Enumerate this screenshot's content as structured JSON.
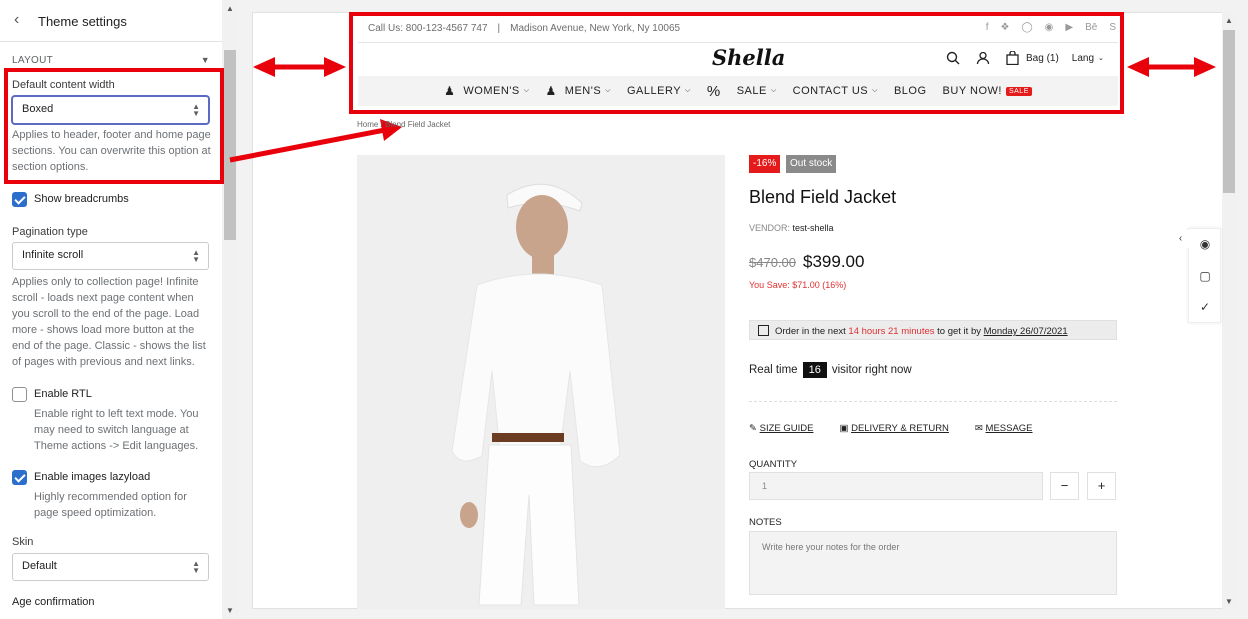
{
  "panel": {
    "title": "Theme settings",
    "section": "LAYOUT",
    "content_width_label": "Default content width",
    "content_width_value": "Boxed",
    "content_width_help": "Applies to header, footer and home page sections. You can overwrite this option at section options.",
    "show_breadcrumbs_label": "Show breadcrumbs",
    "show_breadcrumbs_checked": true,
    "pagination_label": "Pagination type",
    "pagination_value": "Infinite scroll",
    "pagination_help": "Applies only to collection page! Infinite scroll - loads next page content when you scroll to the end of the page. Load more - shows load more button at the end of the page. Classic - shows the list of pages with previous and next links.",
    "rtl_label": "Enable RTL",
    "rtl_checked": false,
    "rtl_help": "Enable right to left text mode. You may need to switch language at Theme actions -> Edit languages.",
    "lazy_label": "Enable images lazyload",
    "lazy_checked": true,
    "lazy_help": "Highly recommended option for page speed optimization.",
    "skin_label": "Skin",
    "skin_value": "Default",
    "age_label": "Age confirmation"
  },
  "store": {
    "topbar_phone": "Call Us: 800-123-4567 747",
    "topbar_separator": "|",
    "topbar_address": "Madison Avenue, New York, Ny 10065",
    "social_icons": [
      "facebook-icon",
      "twitter-icon",
      "instagram-icon",
      "pinterest-icon",
      "youtube-icon",
      "behance-icon",
      "skype-icon"
    ],
    "logo": "Shella",
    "bag_label": "Bag (1)",
    "lang_label": "Lang",
    "nav": [
      {
        "label": "WOMEN'S",
        "icon": "women-icon",
        "dropdown": true
      },
      {
        "label": "MEN'S",
        "icon": "men-icon",
        "dropdown": true
      },
      {
        "label": "GALLERY",
        "dropdown": true
      },
      {
        "label": "%",
        "dropdown": false
      },
      {
        "label": "SALE",
        "dropdown": true
      },
      {
        "label": "CONTACT US",
        "dropdown": true
      },
      {
        "label": "BLOG",
        "dropdown": false
      },
      {
        "label": "BUY NOW!",
        "dropdown": false,
        "badge": "SALE"
      }
    ],
    "breadcrumb": "Home / Blend Field Jacket",
    "badge_discount": "-16%",
    "badge_stock": "Out stock",
    "product_title": "Blend Field Jacket",
    "vendor_label": "VENDOR:",
    "vendor_value": "test-shella",
    "old_price": "$470.00",
    "price": "$399.00",
    "you_save": "You Save: $71.00 (16%)",
    "order_prefix": "Order in the next",
    "order_time": "14 hours 21 minutes",
    "order_middle": "to get it by",
    "order_date": "Monday 26/07/2021",
    "realtime_prefix": "Real time",
    "realtime_count": "16",
    "realtime_suffix": "visitor right now",
    "size_guide": "SIZE GUIDE",
    "delivery": "DELIVERY & RETURN",
    "message": "MESSAGE",
    "quantity_label": "QUANTITY",
    "quantity_value": "1",
    "minus": "−",
    "plus": "+",
    "notes_label": "NOTES",
    "notes_placeholder": "Write here your notes for the order"
  },
  "colors": {
    "annotation_red": "#e8000b",
    "sale_red": "#e51a1a",
    "out_stock_gray": "#8a8a8a",
    "checkbox_blue": "#2c6ecb"
  }
}
